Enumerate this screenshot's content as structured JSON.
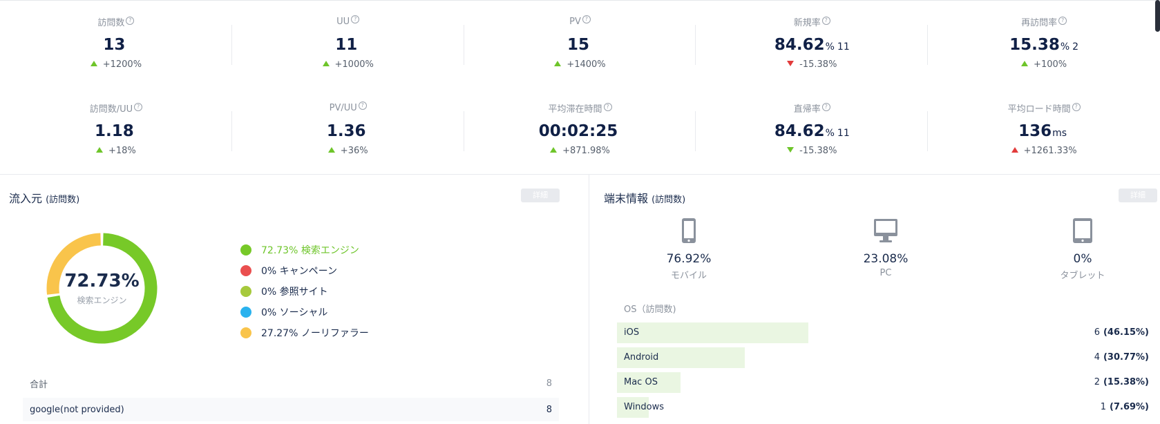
{
  "kpis_row1": [
    {
      "label": "訪問数",
      "value": "13",
      "unit": "",
      "count": "",
      "change": "+1200%",
      "dir": "up-g"
    },
    {
      "label": "UU",
      "value": "11",
      "unit": "",
      "count": "",
      "change": "+1000%",
      "dir": "up-g"
    },
    {
      "label": "PV",
      "value": "15",
      "unit": "",
      "count": "",
      "change": "+1400%",
      "dir": "up-g"
    },
    {
      "label": "新規率",
      "value": "84.62",
      "unit": "%",
      "count": "11",
      "change": "-15.38%",
      "dir": "down-r"
    },
    {
      "label": "再訪問率",
      "value": "15.38",
      "unit": "%",
      "count": "2",
      "change": "+100%",
      "dir": "up-g"
    }
  ],
  "kpis_row2": [
    {
      "label": "訪問数/UU",
      "value": "1.18",
      "unit": "",
      "count": "",
      "change": "+18%",
      "dir": "up-g"
    },
    {
      "label": "PV/UU",
      "value": "1.36",
      "unit": "",
      "count": "",
      "change": "+36%",
      "dir": "up-g"
    },
    {
      "label": "平均滞在時間",
      "value": "00:02:25",
      "unit": "",
      "count": "",
      "change": "+871.98%",
      "dir": "up-g"
    },
    {
      "label": "直帰率",
      "value": "84.62",
      "unit": "%",
      "count": "11",
      "change": "-15.38%",
      "dir": "down-g"
    },
    {
      "label": "平均ロード時間",
      "value": "136",
      "unit": "ms",
      "count": "",
      "change": "+1261.33%",
      "dir": "up-r"
    }
  ],
  "help_glyph": "?",
  "traffic": {
    "title": "流入元",
    "subtitle": "(訪問数)",
    "detail_label": "詳細",
    "donut_value": "72.73%",
    "donut_label": "検索エンジン",
    "legend": [
      {
        "text": "72.73% 検索エンジン",
        "color": "#77c928",
        "share": 72.73
      },
      {
        "text": "0% キャンペーン",
        "color": "#ea4f4f",
        "share": 0
      },
      {
        "text": "0% 参照サイト",
        "color": "#a6c93c",
        "share": 0
      },
      {
        "text": "0% ソーシャル",
        "color": "#2ab2ee",
        "share": 0
      },
      {
        "text": "27.27% ノーリファラー",
        "color": "#f9c44b",
        "share": 27.27
      }
    ],
    "total_label": "合計",
    "total_value": "8",
    "rows": [
      {
        "name": "google(not provided)",
        "value": "8"
      }
    ]
  },
  "devices": {
    "title": "端末情報",
    "subtitle": "(訪問数)",
    "detail_label": "詳細",
    "items": [
      {
        "pct": "76.92%",
        "label": "モバイル",
        "icon": "smartphone-icon"
      },
      {
        "pct": "23.08%",
        "label": "PC",
        "icon": "monitor-icon"
      },
      {
        "pct": "0%",
        "label": "タブレット",
        "icon": "tablet-icon"
      }
    ],
    "os_title": "OS（訪問数)",
    "os": [
      {
        "name": "iOS",
        "count": "6",
        "pct": "(46.15%)",
        "share": 46.15
      },
      {
        "name": "Android",
        "count": "4",
        "pct": "(30.77%)",
        "share": 30.77
      },
      {
        "name": "Mac OS",
        "count": "2",
        "pct": "(15.38%)",
        "share": 15.38
      },
      {
        "name": "Windows",
        "count": "1",
        "pct": "(7.69%)",
        "share": 7.69
      }
    ]
  }
}
